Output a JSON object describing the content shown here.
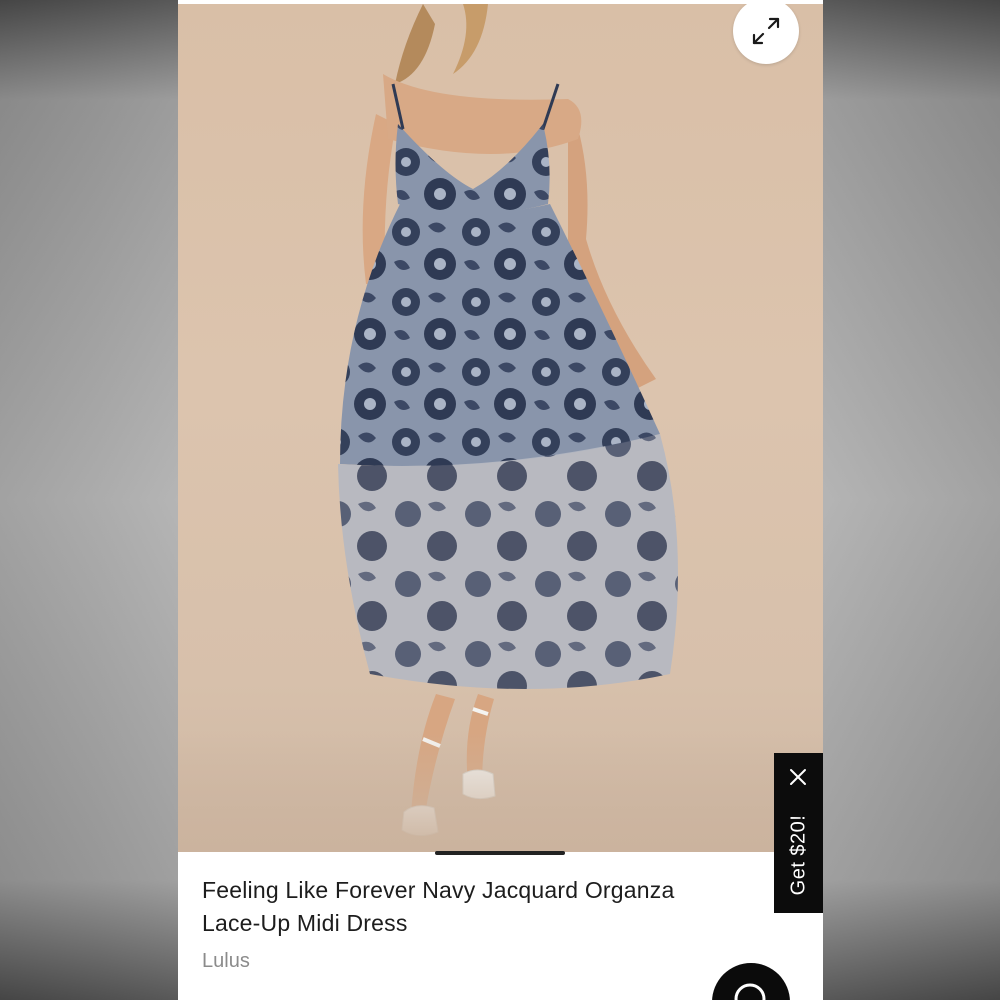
{
  "product": {
    "title_line1": "Feeling Like Forever Navy Jacquard Organza",
    "title_line2": "Lace-Up Midi Dress",
    "brand": "Lulus"
  },
  "promo": {
    "label": "Get $20!"
  },
  "icons": {
    "expand": "expand-arrows-icon",
    "close": "close-icon",
    "search": "search-icon"
  },
  "colors": {
    "dress_navy": "#3b4660",
    "dress_light": "#8e9ab0",
    "backdrop": "#d9bfa7",
    "promo_bg": "#0c0c0c"
  }
}
